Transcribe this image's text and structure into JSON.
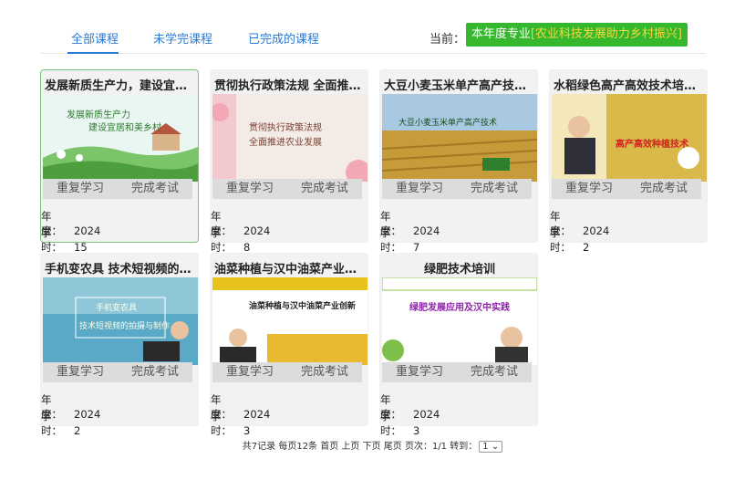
{
  "tabs": {
    "all": "全部课程",
    "unfinished": "未学完课程",
    "finished": "已完成的课程",
    "current_label": "当前：",
    "current_value": "本年度专业",
    "current_highlight": "[农业科技发展助力乡村振兴]"
  },
  "labels": {
    "repeat": "重复学习",
    "exam": "完成考试",
    "year": "年　度：",
    "hours": "学　时："
  },
  "courses": [
    {
      "title": "发展新质生产力，建设宜居...",
      "year": "2024",
      "hours": "15",
      "thumb_text1": "发展新质生产力",
      "thumb_text2": "建设宜居和美乡村"
    },
    {
      "title": "贯彻执行政策法规 全面推进...",
      "year": "2024",
      "hours": "8",
      "thumb_text1": "贯彻执行政策法规",
      "thumb_text2": "全面推进农业发展"
    },
    {
      "title": "大豆小麦玉米单产高产技术...",
      "year": "2024",
      "hours": "7",
      "thumb_text1": "大豆小麦玉米单产高产技术"
    },
    {
      "title": "水稻绿色高产高效技术培训...",
      "year": "2024",
      "hours": "2",
      "thumb_text1": "高产高效种植技术"
    },
    {
      "title": "手机变农具 技术短视频的拍...",
      "year": "2024",
      "hours": "2",
      "thumb_text1": "手机变农具",
      "thumb_text2": "技术短视频的拍摄与制作"
    },
    {
      "title": "油菜种植与汉中油菜产业创...",
      "year": "2024",
      "hours": "3",
      "thumb_text1": "油菜种植与汉中油菜产业创新"
    },
    {
      "title": "绿肥技术培训",
      "year": "2024",
      "hours": "3",
      "thumb_text1": "绿肥发展应用及汉中实践"
    }
  ],
  "pager": {
    "text": "共7记录 每页12条 首页 上页 下页 尾页 页次：1/1 转到：",
    "page": "1"
  }
}
